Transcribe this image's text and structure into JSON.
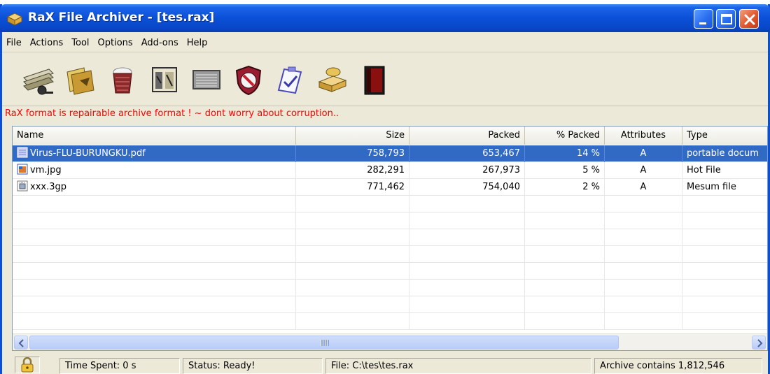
{
  "window": {
    "title": "RaX File Archiver - [tes.rax]"
  },
  "menu": [
    "File",
    "Actions",
    "Tool",
    "Options",
    "Add-ons",
    "Help"
  ],
  "toolbar": {
    "buttons": [
      "new-archive-icon",
      "open-archive-icon",
      "add-files-icon",
      "extract-icon",
      "view-icon",
      "virus-scan-icon",
      "test-icon",
      "wizard-icon",
      "exit-icon"
    ]
  },
  "notice": "RaX format is repairable archive format ! ~ dont worry about corruption..",
  "list": {
    "columns": [
      "Name",
      "Size",
      "Packed",
      "% Packed",
      "Attributes",
      "Type"
    ],
    "rows": [
      {
        "name": "Virus-FLU-BURUNGKU.pdf",
        "size": "758,793",
        "packed": "653,467",
        "pct": "14 %",
        "attr": "A",
        "type": "portable docum",
        "selected": true
      },
      {
        "name": "vm.jpg",
        "size": "282,291",
        "packed": "267,973",
        "pct": "5 %",
        "attr": "A",
        "type": "Hot File",
        "selected": false
      },
      {
        "name": "xxx.3gp",
        "size": "771,462",
        "packed": "754,040",
        "pct": "2 %",
        "attr": "A",
        "type": "Mesum file",
        "selected": false
      }
    ]
  },
  "status": {
    "time_spent": "Time Spent: 0 s",
    "state": "Status: Ready!",
    "file": "File: C:\\tes\\tes.rax",
    "archive": "Archive contains 1,812,546"
  },
  "colors": {
    "accent": "#0a50d8",
    "selection": "#316ac5",
    "notice": "#ff0000"
  }
}
